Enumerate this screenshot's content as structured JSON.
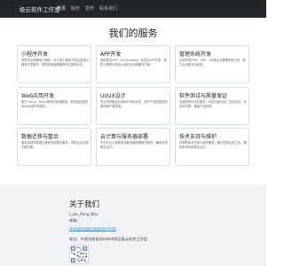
{
  "navbar": {
    "brand": "极云软件工作室",
    "links": [
      "首页",
      "服务",
      "案例",
      "联系我们"
    ]
  },
  "services": {
    "title": "我们的服务",
    "items": [
      {
        "title": "小程序开发",
        "desc": "提供专业的微信小程序、支付宝小程序开发及多端小程序开发服务，帮助您快速搭建移动互联网业务。"
      },
      {
        "title": "APP开发",
        "desc": "提供原生APP（iOS/Android）及混合APP开发，提供从需求分析到上线的全流程解决方案。"
      },
      {
        "title": "管理系统开发",
        "desc": "定制开发CRM、ERP、OA等企业管理系统开发，助力企业数字化转型。"
      },
      {
        "title": "Web应用开发",
        "desc": "基于Vue.js、React等现代前端框架，提供高性能的Web应用开发服务。"
      },
      {
        "title": "UI/UX设计",
        "desc": "专业的界面设计和用户体验优化，提升产品的视觉效果和用户满意度。"
      },
      {
        "title": "软件测试与质量保证",
        "desc": "全面的软件测试服务，包括功能测试、性能测试、安全测试等，确保产品质量。"
      },
      {
        "title": "数据迁移与整合",
        "desc": "提供高效的数据迁移和系统整合服务，帮助企业实现无缝对接。"
      },
      {
        "title": "云计算与服务器部署",
        "desc": "专业的云计算服务及服务器部署维护服务，确保系统稳定运行。"
      },
      {
        "title": "技术支持与维护",
        "desc": "长期的技术支持与维护服务，解决您的后顾之忧，确保系统持续稳定运行。"
      }
    ]
  },
  "footer": {
    "title": "关于我们",
    "qq": "I_am_Peng_Nov",
    "email_label": "邮箱：",
    "email": "shuaipengen@gmail.com",
    "address": "地址：中国河南省郑州市中原区极云软件工作室"
  }
}
